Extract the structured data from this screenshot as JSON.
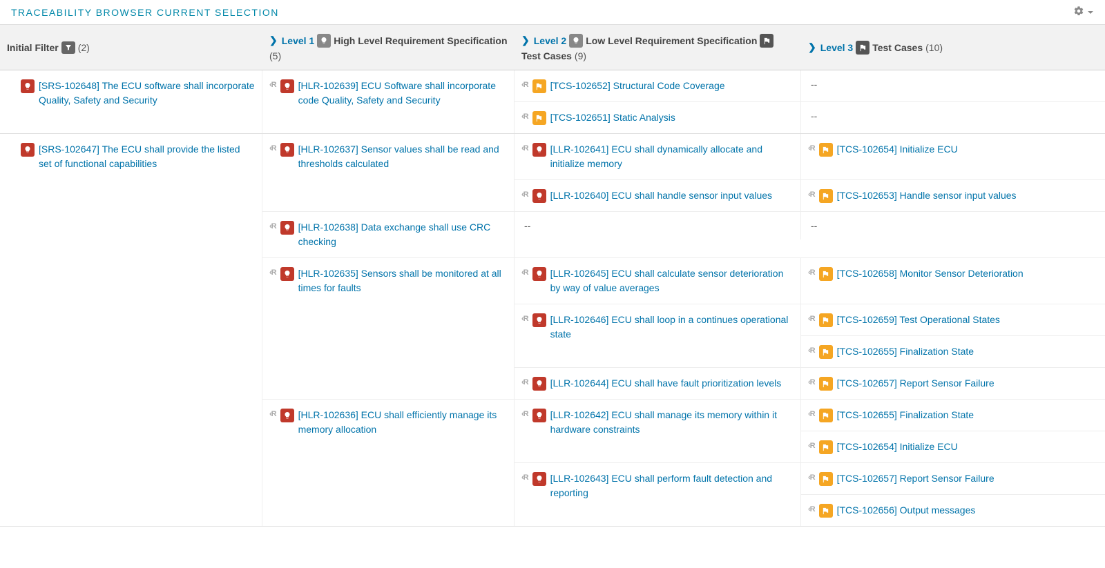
{
  "header": {
    "title": "TRACEABILITY BROWSER CURRENT SELECTION"
  },
  "columns": {
    "initial": {
      "label": "Initial Filter",
      "count": "(2)"
    },
    "level1": {
      "prefix": "Level 1",
      "label": "High Level Requirement Specification",
      "count": "(5)"
    },
    "level2": {
      "prefix": "Level 2",
      "label": "Low Level Requirement Specification",
      "label2": "Test Cases",
      "count": "(9)"
    },
    "level3": {
      "prefix": "Level 3",
      "label": "Test Cases",
      "count": "(10)"
    }
  },
  "rows": [
    {
      "srs": {
        "id": "[SRS-102648]",
        "text": " The ECU software shall incorporate Quality, Safety and Security",
        "type": "req"
      },
      "hlr": [
        {
          "id": "[HLR-102639]",
          "text": " ECU Software shall incorporate code Quality, Safety and Security",
          "type": "req",
          "llr": [
            {
              "id": "[TCS-102652]",
              "text": " Structural Code Coverage",
              "type": "tcs",
              "tcs": [
                {
                  "dash": true
                }
              ]
            },
            {
              "id": "[TCS-102651]",
              "text": " Static Analysis",
              "type": "tcs",
              "tcs": [
                {
                  "dash": true
                }
              ]
            }
          ]
        }
      ]
    },
    {
      "srs": {
        "id": "[SRS-102647]",
        "text": " The ECU shall provide the listed set of functional capabilities",
        "type": "req"
      },
      "hlr": [
        {
          "id": "[HLR-102637]",
          "text": " Sensor values shall be read and thresholds calculated",
          "type": "req",
          "llr": [
            {
              "id": "[LLR-102641]",
              "text": " ECU shall dynamically allocate and initialize memory",
              "type": "req",
              "tcs": [
                {
                  "id": "[TCS-102654]",
                  "text": " Initialize ECU",
                  "type": "tcs"
                }
              ]
            },
            {
              "id": "[LLR-102640]",
              "text": " ECU shall handle sensor input values",
              "type": "req",
              "tcs": [
                {
                  "id": "[TCS-102653]",
                  "text": " Handle sensor input values",
                  "type": "tcs"
                }
              ]
            }
          ]
        },
        {
          "id": "[HLR-102638]",
          "text": " Data exchange shall use CRC checking",
          "type": "req",
          "llr": [
            {
              "dash": true,
              "tcs": [
                {
                  "dash": true
                }
              ]
            }
          ]
        },
        {
          "id": "[HLR-102635]",
          "text": " Sensors shall be monitored at all times for faults",
          "type": "req",
          "llr": [
            {
              "id": "[LLR-102645]",
              "text": " ECU shall calculate sensor deterioration by way of value averages",
              "type": "req",
              "tcs": [
                {
                  "id": "[TCS-102658]",
                  "text": " Monitor Sensor Deterioration",
                  "type": "tcs"
                }
              ]
            },
            {
              "id": "[LLR-102646]",
              "text": " ECU shall loop in a continues operational state",
              "type": "req",
              "tcs": [
                {
                  "id": "[TCS-102659]",
                  "text": " Test Operational States",
                  "type": "tcs"
                },
                {
                  "id": "[TCS-102655]",
                  "text": " Finalization State",
                  "type": "tcs"
                }
              ]
            },
            {
              "id": "[LLR-102644]",
              "text": " ECU shall have fault prioritization levels",
              "type": "req",
              "tcs": [
                {
                  "id": "[TCS-102657]",
                  "text": " Report Sensor Failure",
                  "type": "tcs"
                }
              ]
            }
          ]
        },
        {
          "id": "[HLR-102636]",
          "text": " ECU shall efficiently manage its memory allocation",
          "type": "req",
          "llr": [
            {
              "id": "[LLR-102642]",
              "text": " ECU shall manage its memory within it hardware constraints",
              "type": "req",
              "tcs": [
                {
                  "id": "[TCS-102655]",
                  "text": " Finalization State",
                  "type": "tcs"
                },
                {
                  "id": "[TCS-102654]",
                  "text": " Initialize ECU",
                  "type": "tcs"
                }
              ]
            },
            {
              "id": "[LLR-102643]",
              "text": " ECU shall perform fault detection and reporting",
              "type": "req",
              "tcs": [
                {
                  "id": "[TCS-102657]",
                  "text": " Report Sensor Failure",
                  "type": "tcs"
                },
                {
                  "id": "[TCS-102656]",
                  "text": " Output messages",
                  "type": "tcs"
                }
              ]
            }
          ]
        }
      ]
    }
  ]
}
